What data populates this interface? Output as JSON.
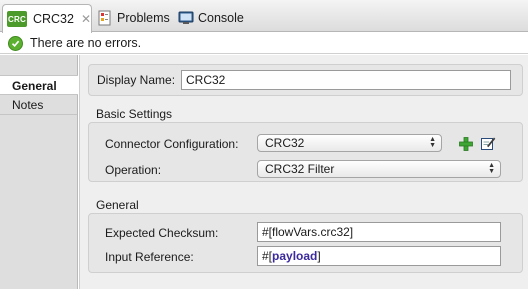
{
  "tabs": [
    {
      "label": "CRC32",
      "badge": "CRC",
      "active": true,
      "closable": true
    },
    {
      "label": "Problems",
      "icon": "problems-icon"
    },
    {
      "label": "Console",
      "icon": "console-icon"
    }
  ],
  "status": {
    "message": "There are no errors.",
    "icon": "check-circle-icon"
  },
  "nav": {
    "items": [
      {
        "label": "General",
        "active": true
      },
      {
        "label": "Notes",
        "active": false
      }
    ]
  },
  "form": {
    "display_name_label": "Display Name:",
    "display_name_value": "CRC32",
    "basic_settings": {
      "title": "Basic Settings",
      "connector_label": "Connector Configuration:",
      "connector_value": "CRC32",
      "operation_label": "Operation:",
      "operation_value": "CRC32 Filter"
    },
    "general": {
      "title": "General",
      "checksum_label": "Expected Checksum:",
      "checksum_value": "#[flowVars.crc32]",
      "input_ref_label": "Input Reference:",
      "input_ref_prefix": "#[",
      "input_ref_keyword": "payload",
      "input_ref_suffix": "]"
    }
  },
  "colors": {
    "badge": "#4c9a2a",
    "ok": "#5bb02f",
    "add_icon": "#3fa535"
  }
}
